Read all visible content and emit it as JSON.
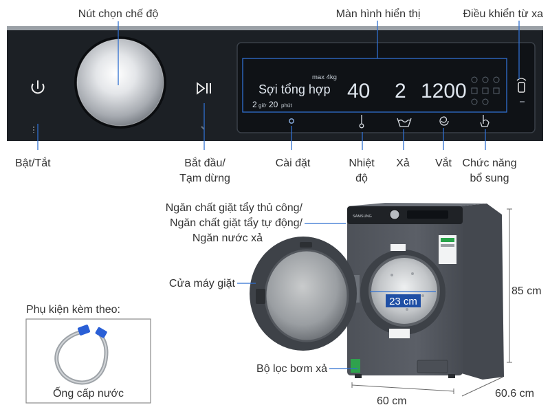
{
  "top_labels": {
    "selector_knob": "Nút chọn chế độ",
    "display_screen": "Màn hình hiển thị",
    "remote_control": "Điều khiển từ xa"
  },
  "panel_labels": {
    "power": "Bật/Tắt",
    "start_pause_line1": "Bắt đầu/",
    "start_pause_line2": "Tạm dừng",
    "settings": "Cài đặt",
    "temperature_line1": "Nhiệt",
    "temperature_line2": "độ",
    "rinse": "Xả",
    "spin": "Vắt",
    "extra_line1": "Chức năng",
    "extra_line2": "bổ sung"
  },
  "display": {
    "max_load": "max 4kg",
    "program": "Sợi tổng hợp",
    "time_hours": "2",
    "time_hours_unit": "giờ",
    "time_minutes": "20",
    "time_minutes_unit": "phút",
    "temperature": "40",
    "rinse_count": "2",
    "spin_speed": "1200"
  },
  "machine_labels": {
    "dispenser_line1": "Ngăn chất giặt tẩy thủ công/",
    "dispenser_line2": "Ngăn chất giặt tẩy tự động/",
    "dispenser_line3": "Ngăn nước xả",
    "door": "Cửa máy giặt",
    "drum_diameter": "23 cm",
    "drain_filter": "Bộ lọc bơm xả",
    "height": "85 cm",
    "width": "60 cm",
    "depth": "60.6 cm",
    "brand": "SAMSUNG"
  },
  "accessories": {
    "title": "Phụ kiện kèm theo:",
    "item": "Ống cấp nước"
  },
  "colors": {
    "panel": "#1c2025",
    "display_text": "#dfe6ee",
    "leader": "#2f6fd0",
    "machine_body": "#545860",
    "hose_connector": "#2a5fd6"
  }
}
